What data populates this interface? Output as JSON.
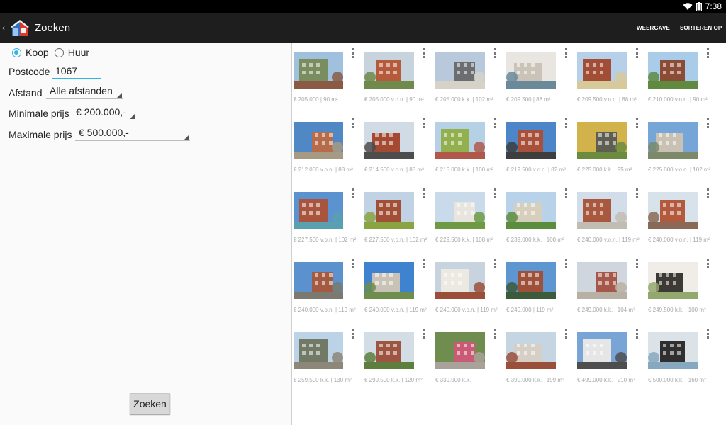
{
  "status_bar": {
    "time": "7:38"
  },
  "action_bar": {
    "title": "Zoeken",
    "actions": [
      "WEERGAVE",
      "SORTEREN OP"
    ]
  },
  "form": {
    "type_options": [
      {
        "label": "Koop",
        "checked": true
      },
      {
        "label": "Huur",
        "checked": false
      }
    ],
    "postcode_label": "Postcode",
    "postcode_value": "1067",
    "distance_label": "Afstand",
    "distance_value": "Alle afstanden",
    "min_price_label": "Minimale prijs",
    "min_price_value": "€ 200.000,-",
    "max_price_label": "Maximale prijs",
    "max_price_value": "€ 500.000,-",
    "search_button": "Zoeken"
  },
  "listings": [
    {
      "caption": "€ 205.000 | 90 m²",
      "palette": [
        "#9fc1de",
        "#7a8d5e",
        "#8a5a45"
      ]
    },
    {
      "caption": "€ 205.000 v.o.n. | 90 m²",
      "palette": [
        "#c7d3dd",
        "#b65a3c",
        "#6f8a4a"
      ]
    },
    {
      "caption": "€ 205.000 k.k. | 102 m²",
      "palette": [
        "#b8c9dc",
        "#6b6d70",
        "#d7d2c8"
      ]
    },
    {
      "caption": "€ 209.500 | 88 m²",
      "palette": [
        "#e9e6e1",
        "#c9c3b8",
        "#6a8a9a"
      ]
    },
    {
      "caption": "€ 209.500 v.o.n. | 88 m²",
      "palette": [
        "#b7d0ea",
        "#a24e36",
        "#d8c99a"
      ]
    },
    {
      "caption": "€ 210.000 v.o.n. | 90 m²",
      "palette": [
        "#a9cde9",
        "#8b4b35",
        "#5f8a3f"
      ]
    },
    {
      "caption": "€ 212.000 v.o.n. | 88 m²",
      "palette": [
        "#4f88c5",
        "#b66b4a",
        "#a79a82"
      ]
    },
    {
      "caption": "€ 214.500 v.o.n. | 88 m²",
      "palette": [
        "#d0dbe5",
        "#a44a33",
        "#4d4d4d"
      ]
    },
    {
      "caption": "€ 215.000 k.k. | 100 m²",
      "palette": [
        "#b6d0e6",
        "#93b04f",
        "#b0594a"
      ]
    },
    {
      "caption": "€ 219.500 v.o.n. | 82 m²",
      "palette": [
        "#4c86c8",
        "#a8503a",
        "#3e3e3e"
      ]
    },
    {
      "caption": "€ 225.000 k.k. | 95 m²",
      "palette": [
        "#d2b24a",
        "#5e5e52",
        "#6b8c3f"
      ]
    },
    {
      "caption": "€ 225.000 v.o.n. | 102 m²",
      "palette": [
        "#76a6d8",
        "#c9c2b4",
        "#7c8a6a"
      ]
    },
    {
      "caption": "€ 227.500 v.o.n. | 102 m²",
      "palette": [
        "#5a93cf",
        "#a9553d",
        "#59a0b0"
      ]
    },
    {
      "caption": "€ 227.500 v.o.n. | 102 m²",
      "palette": [
        "#c0d2e3",
        "#a24f37",
        "#8aa441"
      ]
    },
    {
      "caption": "€ 229.500 k.k. | 108 m²",
      "palette": [
        "#c9dbea",
        "#e8e5df",
        "#6d9a43"
      ]
    },
    {
      "caption": "€ 239.000 k.k. | 100 m²",
      "palette": [
        "#b8d2ea",
        "#d7cfbe",
        "#5c8d3c"
      ]
    },
    {
      "caption": "€ 240.000 v.o.n. | 119 m²",
      "palette": [
        "#d1dde8",
        "#a8583e",
        "#c2bdb3"
      ]
    },
    {
      "caption": "€ 240.000 v.o.n. | 119 m²",
      "palette": [
        "#d8e2ea",
        "#b35a3e",
        "#8a6a56"
      ]
    },
    {
      "caption": "€ 240.000 v.o.n. | 119 m²",
      "palette": [
        "#5b91cc",
        "#a35a40",
        "#7a7a70"
      ]
    },
    {
      "caption": "€ 240.000 v.o.n. | 119 m²",
      "palette": [
        "#3f82cf",
        "#c9c3b7",
        "#6f8d4d"
      ]
    },
    {
      "caption": "€ 240.000 v.o.n. | 119 m²",
      "palette": [
        "#c7d4df",
        "#ece9e3",
        "#9b4f39"
      ]
    },
    {
      "caption": "€ 240.000 | 119 m²",
      "palette": [
        "#5d96d0",
        "#9e5138",
        "#3c5b3a"
      ]
    },
    {
      "caption": "€ 249.000 k.k. | 104 m²",
      "palette": [
        "#cfd6de",
        "#a5574a",
        "#b8b0a2"
      ]
    },
    {
      "caption": "€ 249.500 k.k. | 100 m²",
      "palette": [
        "#f0ede8",
        "#3d3a35",
        "#93a86c"
      ]
    },
    {
      "caption": "€ 259.500 k.k. | 130 m²",
      "palette": [
        "#bcd2e6",
        "#717a66",
        "#8c8778"
      ]
    },
    {
      "caption": "€ 299.500 k.k. | 120 m²",
      "palette": [
        "#d2dde6",
        "#9d5440",
        "#5d7e3c"
      ]
    },
    {
      "caption": "€ 339.000 k.k.",
      "palette": [
        "#6f8d4e",
        "#c95b77",
        "#a9a29a"
      ]
    },
    {
      "caption": "€ 390.000 k.k. | 199 m²",
      "palette": [
        "#c5d5e2",
        "#d5cfc5",
        "#9a4f3a"
      ]
    },
    {
      "caption": "€ 499.000 k.k. | 210 m²",
      "palette": [
        "#78a5d6",
        "#e6e6e6",
        "#4e4e4e"
      ]
    },
    {
      "caption": "€ 500.000 k.k. | 160 m²",
      "palette": [
        "#dce3e8",
        "#2f2f2f",
        "#88a8c0"
      ]
    }
  ]
}
